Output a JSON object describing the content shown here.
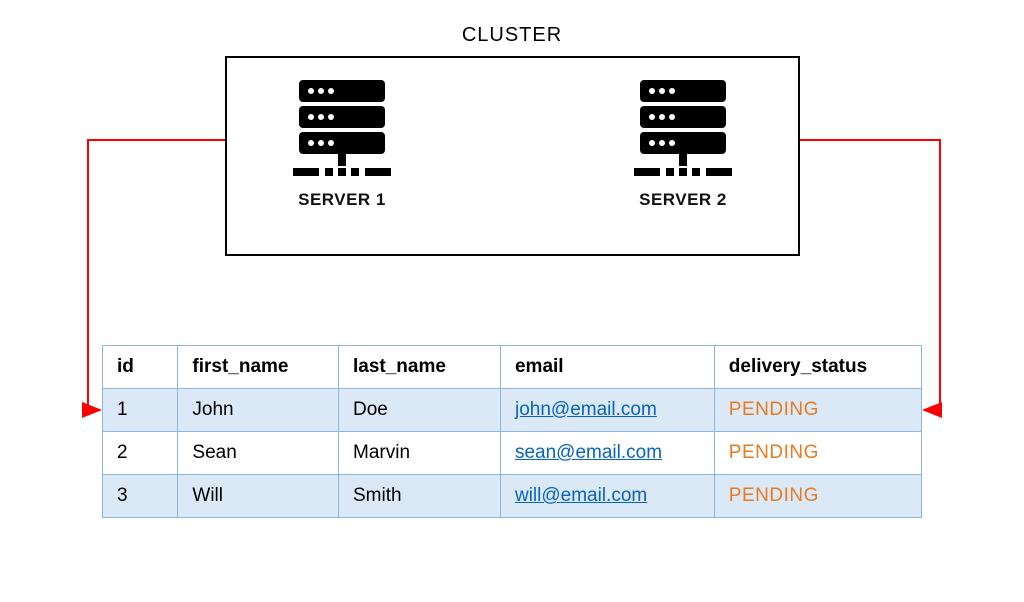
{
  "cluster": {
    "title": "CLUSTER",
    "servers": [
      {
        "label": "SERVER 1"
      },
      {
        "label": "SERVER 2"
      }
    ]
  },
  "table": {
    "columns": [
      "id",
      "first_name",
      "last_name",
      "email",
      "delivery_status"
    ],
    "rows": [
      {
        "id": "1",
        "first_name": "John",
        "last_name": "Doe",
        "email": "john@email.com",
        "delivery_status": "PENDING"
      },
      {
        "id": "2",
        "first_name": "Sean",
        "last_name": "Marvin",
        "email": "sean@email.com",
        "delivery_status": "PENDING"
      },
      {
        "id": "3",
        "first_name": "Will",
        "last_name": "Smith",
        "email": "will@email.com",
        "delivery_status": "PENDING"
      }
    ]
  },
  "colors": {
    "arrow": "#ff0000",
    "status": "#e87b22",
    "link": "#0563c1",
    "table_border": "#8db6df",
    "table_stripe": "#dbe9f6"
  }
}
